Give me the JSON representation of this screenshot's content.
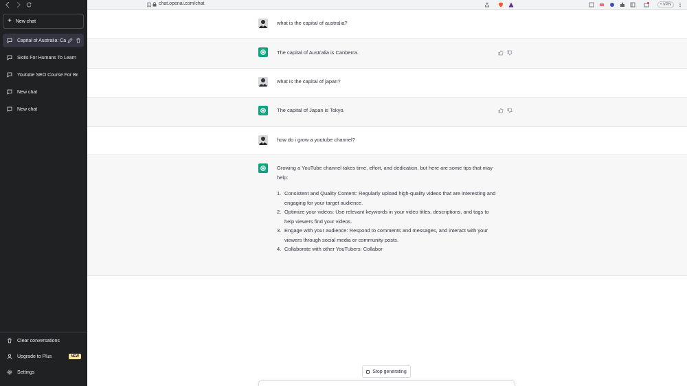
{
  "browser": {
    "url": "chat.openai.com/chat",
    "vpn_label": "• VPN"
  },
  "sidebar": {
    "new_chat_label": "New chat",
    "items": [
      {
        "label": "Capital of Australia: Ca",
        "active": true
      },
      {
        "label": "Skills For Humans To Learn",
        "active": false
      },
      {
        "label": "Youtube SEO Course For Beg",
        "active": false
      },
      {
        "label": "New chat",
        "active": false
      },
      {
        "label": "New chat",
        "active": false
      }
    ],
    "bottom": {
      "clear_label": "Clear conversations",
      "upgrade_label": "Upgrade to Plus",
      "new_badge": "NEW",
      "settings_label": "Settings"
    }
  },
  "chat": {
    "messages": [
      {
        "role": "user",
        "text": "what is the capital of australia?"
      },
      {
        "role": "assistant",
        "text": "The capital of Australia is Canberra."
      },
      {
        "role": "user",
        "text": "what is the capital of japan?"
      },
      {
        "role": "assistant",
        "text": "The capital of Japan is Tokyo."
      },
      {
        "role": "user",
        "text": "how do i grow a youtube channel?"
      },
      {
        "role": "assistant",
        "intro": "Growing a YouTube channel takes time, effort, and dedication, but here are some tips that may help:",
        "list": [
          {
            "num": "1.",
            "text": "Consistent and Quality Content: Regularly upload high-quality videos that are interesting and engaging for your target audience."
          },
          {
            "num": "2.",
            "text": "Optimize your videos: Use relevant keywords in your video titles, descriptions, and tags to help viewers find your videos."
          },
          {
            "num": "3.",
            "text": "Engage with your audience: Respond to comments and messages, and interact with your viewers through social media or community posts."
          },
          {
            "num": "4.",
            "text": "Collaborate with other YouTubers: Collabor"
          }
        ]
      }
    ],
    "stop_label": "Stop generating"
  },
  "colors": {
    "sidebar_bg": "#202123",
    "assistant_bg": "#f7f7f8",
    "brand_green": "#10a37f",
    "plus_badge": "#fae69e"
  }
}
